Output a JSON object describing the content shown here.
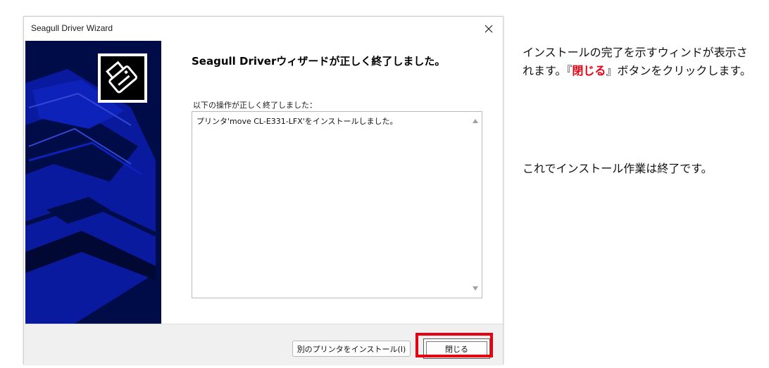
{
  "window": {
    "title": "Seagull Driver Wizard",
    "close_symbol": "×"
  },
  "icons": {
    "logo": "printer-logo-icon",
    "close": "close-icon",
    "scroll_up": "scroll-up-arrow-icon",
    "scroll_down": "scroll-down-arrow-icon"
  },
  "content": {
    "heading": "Seagull Driverウィザードが正しく終了しました。",
    "result_label": "以下の操作が正しく終了しました：",
    "result_text": "プリンタ'move CL-E331-LFX'をインストールしました。"
  },
  "buttons": {
    "install_other": "別のプリンタをインストール(I)",
    "close": "閉じる"
  },
  "instructions": {
    "line1_part1": "インストールの完了を示すウィンドが表示されます。『",
    "line1_emphasis": "閉じる",
    "line1_part2": "』ボタンをクリックします。",
    "line2": "これでインストール作業は終了です。"
  },
  "colors": {
    "banner": "#000c47",
    "banner_accent": "#0a1a9e",
    "highlight": "#e50012"
  }
}
